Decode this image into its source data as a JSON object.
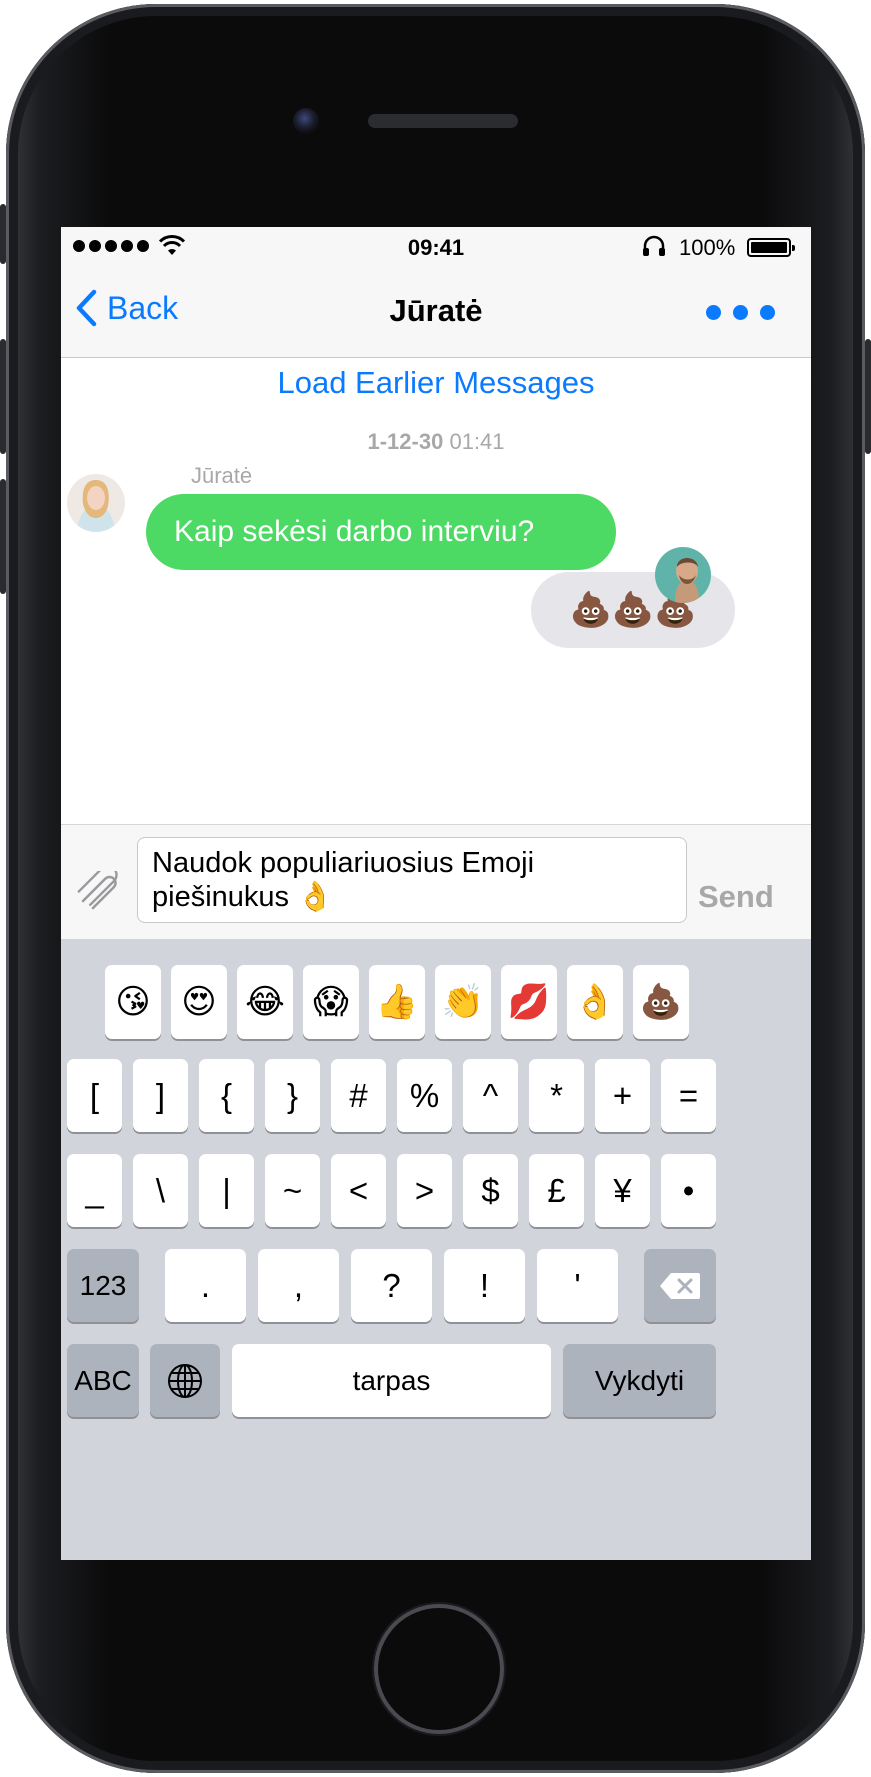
{
  "status_bar": {
    "time": "09:41",
    "battery_percent": "100%",
    "signal_bars": 5
  },
  "nav": {
    "back_label": "Back",
    "title": "Jūratė"
  },
  "chat": {
    "load_earlier": "Load Earlier Messages",
    "timestamp_date": "1-12-30",
    "timestamp_time": "01:41",
    "incoming_sender": "Jūratė",
    "incoming_text": "Kaip sekėsi darbo interviu?",
    "outgoing_text": "💩💩💩"
  },
  "composer": {
    "text": "Naudok populiariuosius Emoji piešinukus 👌",
    "send_label": "Send"
  },
  "keyboard": {
    "emoji_row": [
      "😘",
      "😍",
      "😂",
      "😱",
      "👍",
      "👏",
      "💋",
      "👌",
      "💩"
    ],
    "row1": [
      "[",
      "]",
      "{",
      "}",
      "#",
      "%",
      "^",
      "*",
      "+",
      "="
    ],
    "row2": [
      "_",
      "\\",
      "|",
      "~",
      "<",
      ">",
      "$",
      "£",
      "¥",
      "•"
    ],
    "row3": [
      ".",
      ",",
      "?",
      "!",
      "'"
    ],
    "key_123": "123",
    "key_abc": "ABC",
    "space_label": "tarpas",
    "return_label": "Vykdyti"
  },
  "colors": {
    "accent": "#0a7aff",
    "incoming_bubble": "#4cd964",
    "outgoing_bubble": "#e5e5ea"
  }
}
